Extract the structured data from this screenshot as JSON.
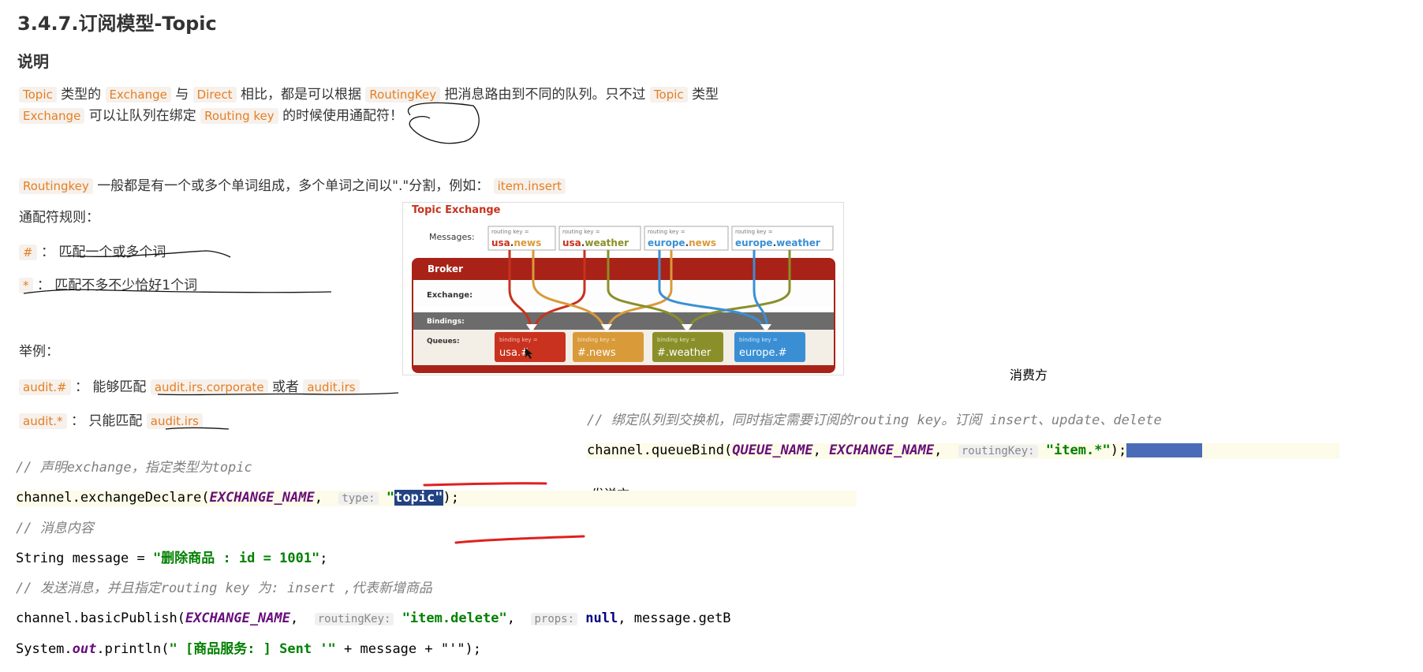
{
  "doc": {
    "title": "3.4.7.订阅模型-Topic",
    "section": "说明",
    "desc1": {
      "c1": "Topic",
      "t1": "类型的",
      "c2": "Exchange",
      "t2": "与",
      "c3": "Direct",
      "t3": "相比，都是可以根据",
      "c4": "RoutingKey",
      "t4": "把消息路由到不同的队列。只不过",
      "c5": "Topic",
      "t5": "类型"
    },
    "desc2": {
      "c1": "Exchange",
      "t1": "可以让队列在绑定",
      "c2": "Routing key",
      "t2": "的时候使用通配符！"
    },
    "routing": {
      "c1": "Routingkey",
      "t1": "一般都是有一个或多个单词组成，多个单词之间以\".\"分割，例如：",
      "c2": "item.insert"
    },
    "rules_title": "通配符规则：",
    "rule1": {
      "c": "#",
      "t": "：  匹配一个或多个词"
    },
    "rule2": {
      "c": "*",
      "t": "：  匹配不多不少恰好1个词"
    },
    "example_title": "举例：",
    "ex1": {
      "c1": "audit.#",
      "t1": "：  能够匹配",
      "c2": "audit.irs.corporate",
      "t2": "或者",
      "c3": "audit.irs"
    },
    "ex2": {
      "c1": "audit.*",
      "t1": "：  只能匹配",
      "c2": "audit.irs"
    }
  },
  "diagram": {
    "title": "Topic Exchange",
    "messages_label": "Messages:",
    "rk_prefix": "routing key =",
    "messages": [
      {
        "pre": "usa",
        "post": "news"
      },
      {
        "pre": "usa",
        "post": "weather"
      },
      {
        "pre": "europe",
        "post": "news"
      },
      {
        "pre": "europe",
        "post": "weather"
      }
    ],
    "broker": "Broker",
    "exchange_label": "Exchange:",
    "bindings_label": "Bindings:",
    "queues_label": "Queues:",
    "bk_prefix": "binding key =",
    "queues": [
      "usa.#",
      "#.news",
      "#.weather",
      "europe.#"
    ],
    "colors": {
      "red": "#c8321e",
      "orange": "#d99a3a",
      "green": "#8a8f2a",
      "blue": "#3a8fd4",
      "broker": "#a82218"
    }
  },
  "labels": {
    "consumer": "消费方",
    "sender": "发送方"
  },
  "consumer_code": {
    "comment": "// 绑定队列到交换机，同时指定需要订阅的routing key。订阅 insert、update、delete",
    "l_pre": "channel.queueBind(",
    "c1": "QUEUE_NAME",
    "sep": ", ",
    "c2": "EXCHANGE_NAME",
    "sep2": ",  ",
    "hint": "routingKey:",
    "str": "\"item.*\"",
    "end": ");"
  },
  "sender_code": {
    "comment1": "// 声明exchange，指定类型为topic",
    "l1_pre": "channel.exchangeDeclare(",
    "l1_const": "EXCHANGE_NAME",
    "l1_sep": ",  ",
    "l1_hint": "type:",
    "l1_str_q": "\"",
    "l1_str": "topic\"",
    "l1_end": ");",
    "comment2": "// 消息内容",
    "l2_pre": "String message = ",
    "l2_str": "\"删除商品 : id = 1001\"",
    "l2_end": ";",
    "comment3": "// 发送消息，并且指定routing key 为: insert ,代表新增商品",
    "l3_pre": "channel.basicPublish(",
    "l3_const": "EXCHANGE_NAME",
    "l3_sep": ",  ",
    "l3_hint": "routingKey:",
    "l3_str": "\"item.delete\"",
    "l3_sep2": ",  ",
    "l3_hint2": "props:",
    "l3_kw": "null",
    "l3_end": ", message.getB",
    "l4_pre": "System.",
    "l4_out": "out",
    "l4_mid": ".println(",
    "l4_str": "\" [商品服务: ] Sent '\"",
    "l4_end": " + message + \"'\");"
  }
}
